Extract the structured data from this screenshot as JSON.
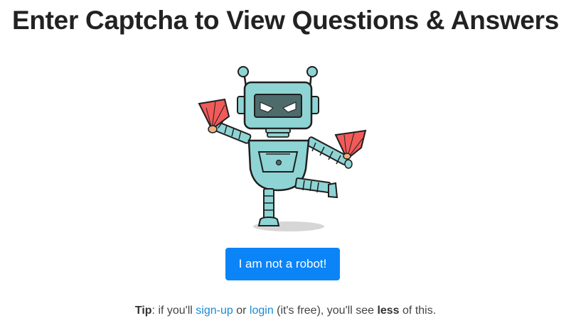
{
  "header": {
    "title": "Enter Captcha to View Questions & Answers"
  },
  "illustration": {
    "subject": "robot-holding-fans",
    "colors": {
      "body": "#8fd4d4",
      "outline": "#1f1f1f",
      "visor": "#4d6b6b",
      "fan": "#f25a5a",
      "shadow": "#d6d6d6"
    }
  },
  "captcha": {
    "button_label": "I am not a robot!",
    "button_color": "#0b84f7"
  },
  "tip": {
    "label": "Tip",
    "text_before_signup": ": if you'll ",
    "signup_link": "sign-up",
    "text_between": " or ",
    "login_link": "login",
    "text_after_login": " (it's free), you'll see ",
    "emphasis": "less",
    "text_end": " of this.",
    "link_color": "#1a8ad4"
  }
}
